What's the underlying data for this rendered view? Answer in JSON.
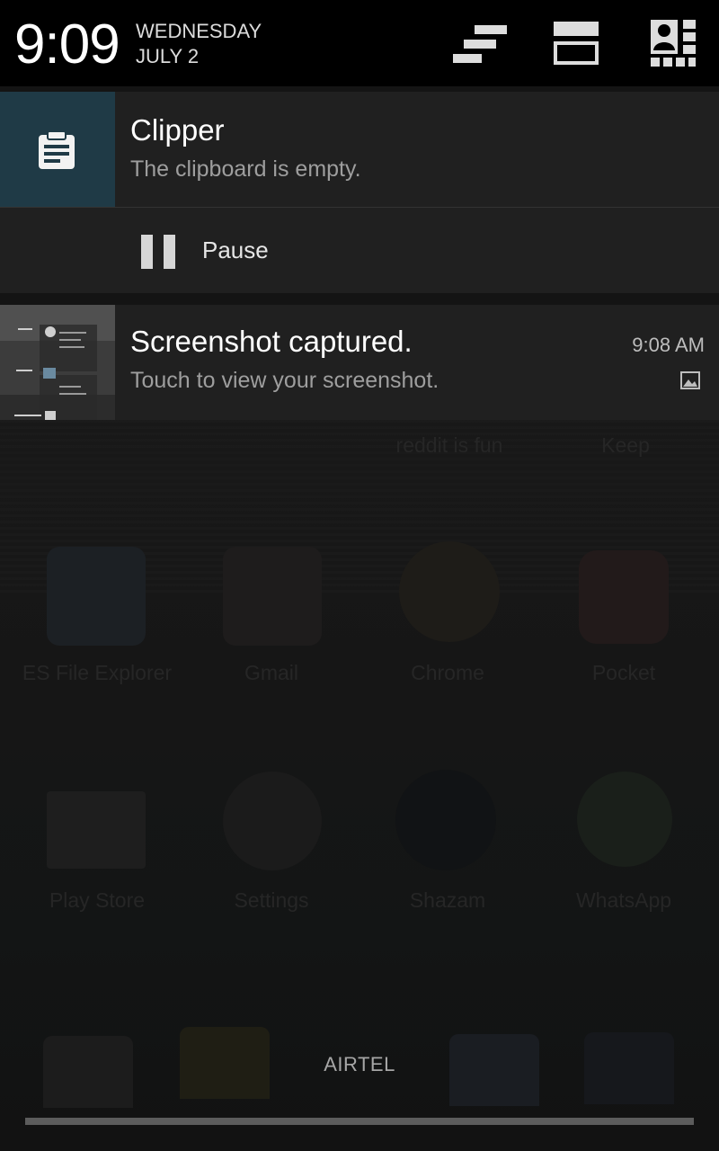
{
  "status_bar": {
    "time": "9:09",
    "day": "WEDNESDAY",
    "date": "JULY 2",
    "buttons": [
      {
        "name": "clear-all",
        "icon": "clear-notifications-icon"
      },
      {
        "name": "quick-settings",
        "icon": "quick-settings-icon"
      },
      {
        "name": "user-profile",
        "icon": "user-profile-icon"
      }
    ]
  },
  "notifications": {
    "clipper": {
      "icon": "clipboard-icon",
      "icon_bg": "#1f3a46",
      "title": "Clipper",
      "text": "The clipboard is empty.",
      "action_label": "Pause",
      "action_icon": "pause-icon"
    },
    "screenshot": {
      "title": "Screenshot captured.",
      "text": "Touch to view your screenshot.",
      "time": "9:08 AM",
      "small_icon": "image-icon"
    }
  },
  "home_screen": {
    "apps_row_top": [
      "reddit is fun",
      "Keep"
    ],
    "apps_row_1": [
      "ES File Explorer",
      "Gmail",
      "Chrome",
      "Pocket"
    ],
    "apps_row_2": [
      "Play Store",
      "Settings",
      "Shazam",
      "WhatsApp"
    ]
  },
  "footer": {
    "carrier": "AIRTEL"
  },
  "colors": {
    "header_bg": "#000000",
    "card_bg": "#202020",
    "accent_icon_bg": "#1f3a46"
  }
}
